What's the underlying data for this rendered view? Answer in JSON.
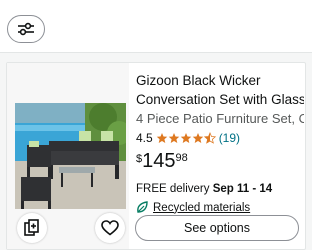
{
  "colors": {
    "star": "#de7921",
    "link": "#007185",
    "border": "#8d9096"
  },
  "filter": {
    "icon": "sliders-icon"
  },
  "product": {
    "title_line1": "Gizoon Black Wicker",
    "title_line2": "Conversation Set with Glass…",
    "subtitle": "4 Piece Patio Furniture Set, O…",
    "rating": "4.5",
    "stars_value": 4.5,
    "review_count": "(19)",
    "price_currency": "$",
    "price_whole": "145",
    "price_fraction": "98",
    "delivery_prefix": "FREE delivery",
    "delivery_dates": "Sep 11 - 14",
    "recycled_label": "Recycled materials",
    "recycled_icon": "leaf-icon",
    "see_options": "See options",
    "compare_icon": "compare-add-icon",
    "wishlist_icon": "heart-icon"
  }
}
